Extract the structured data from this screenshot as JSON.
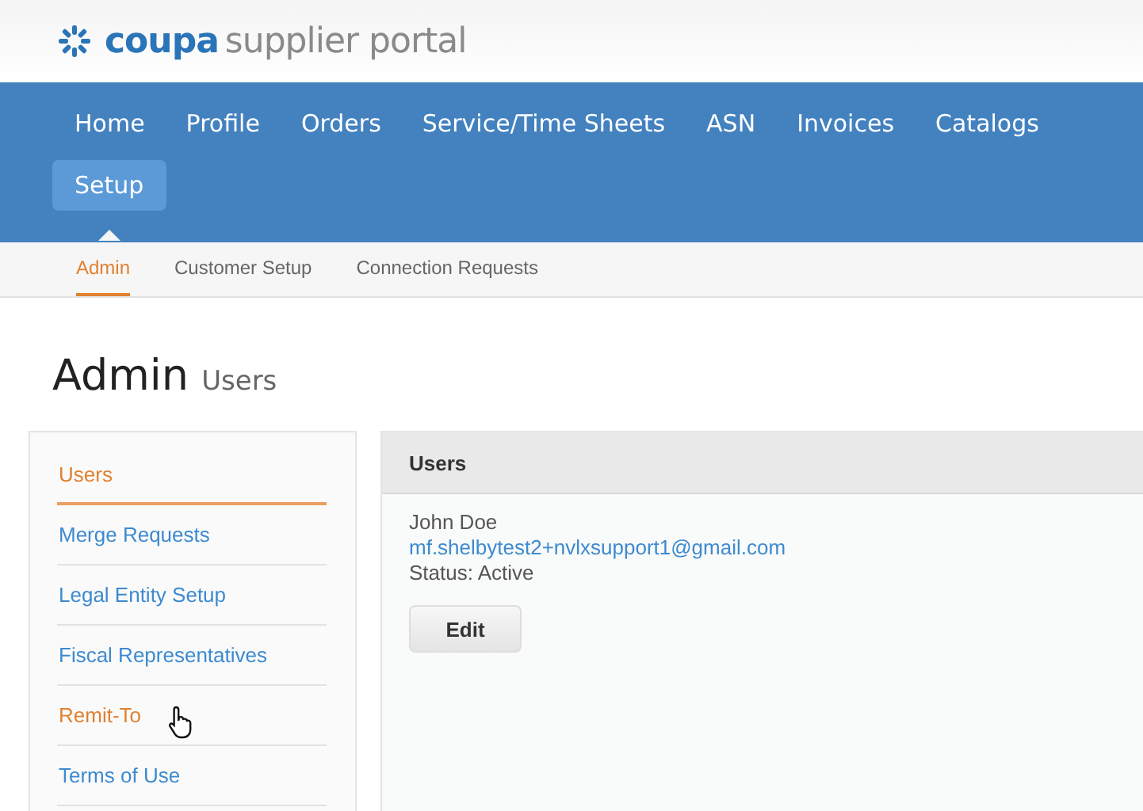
{
  "header": {
    "brand": "coupa",
    "tagline": "supplier portal"
  },
  "nav": [
    {
      "label": "Home",
      "selected": false
    },
    {
      "label": "Profile",
      "selected": false
    },
    {
      "label": "Orders",
      "selected": false
    },
    {
      "label": "Service/Time Sheets",
      "selected": false
    },
    {
      "label": "ASN",
      "selected": false
    },
    {
      "label": "Invoices",
      "selected": false
    },
    {
      "label": "Catalogs",
      "selected": false
    },
    {
      "label": "Setup",
      "selected": true
    }
  ],
  "subnav": [
    {
      "label": "Admin",
      "selected": true
    },
    {
      "label": "Customer Setup",
      "selected": false
    },
    {
      "label": "Connection Requests",
      "selected": false
    }
  ],
  "page_title": {
    "title": "Admin",
    "subtitle": "Users"
  },
  "sidebar": {
    "items": [
      {
        "label": "Users",
        "selected": true,
        "hovered": false
      },
      {
        "label": "Merge Requests",
        "selected": false,
        "hovered": false
      },
      {
        "label": "Legal Entity Setup",
        "selected": false,
        "hovered": false
      },
      {
        "label": "Fiscal Representatives",
        "selected": false,
        "hovered": false
      },
      {
        "label": "Remit-To",
        "selected": false,
        "hovered": true
      },
      {
        "label": "Terms of Use",
        "selected": false,
        "hovered": false
      }
    ]
  },
  "panel": {
    "title": "Users",
    "user": {
      "name": "John Doe",
      "email": "mf.shelbytest2+nvlxsupport1@gmail.com",
      "status": "Status: Active"
    },
    "button": "Edit"
  }
}
